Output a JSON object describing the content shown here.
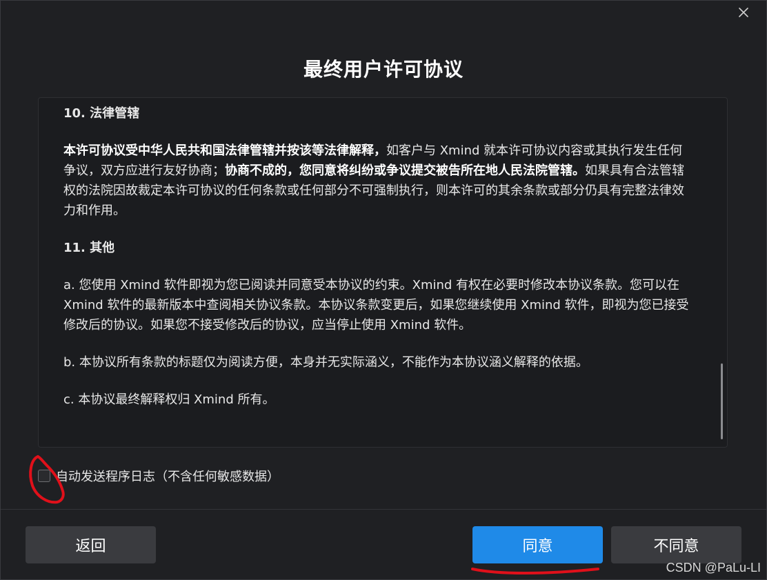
{
  "dialog": {
    "title": "最终用户许可协议",
    "close_icon": "close-icon"
  },
  "content": {
    "section10": {
      "heading": "10. 法律管辖",
      "bold1": "本许可协议受中华人民共和国法律管辖并按该等法律解释，",
      "text1": "如客户与 Xmind 就本许可协议内容或其执行发生任何争议，双方应进行友好协商；",
      "bold2": "协商不成的，您同意将纠纷或争议提交被告所在地人民法院管辖。",
      "text2": "如果具有合法管辖权的法院因故裁定本许可协议的任何条款或任何部分不可强制执行，则本许可的其余条款或部分仍具有完整法律效力和作用。"
    },
    "section11": {
      "heading": "11. 其他",
      "item_a": "a. 您使用 Xmind 软件即视为您已阅读并同意受本协议的约束。Xmind 有权在必要时修改本协议条款。您可以在 Xmind 软件的最新版本中查阅相关协议条款。本协议条款变更后，如果您继续使用 Xmind 软件，即视为您已接受修改后的协议。如果您不接受修改后的协议，应当停止使用 Xmind 软件。",
      "item_b": "b. 本协议所有条款的标题仅为阅读方便，本身并无实际涵义，不能作为本协议涵义解释的依据。",
      "item_c": "c. 本协议最终解释权归 Xmind 所有。"
    }
  },
  "checkbox": {
    "label": "自动发送程序日志（不含任何敏感数据）",
    "checked": false
  },
  "buttons": {
    "back": "返回",
    "agree": "同意",
    "disagree": "不同意"
  },
  "colors": {
    "accent": "#1f8ae8",
    "annotation": "#e0101a"
  },
  "watermark": "CSDN @PaLu-LI"
}
